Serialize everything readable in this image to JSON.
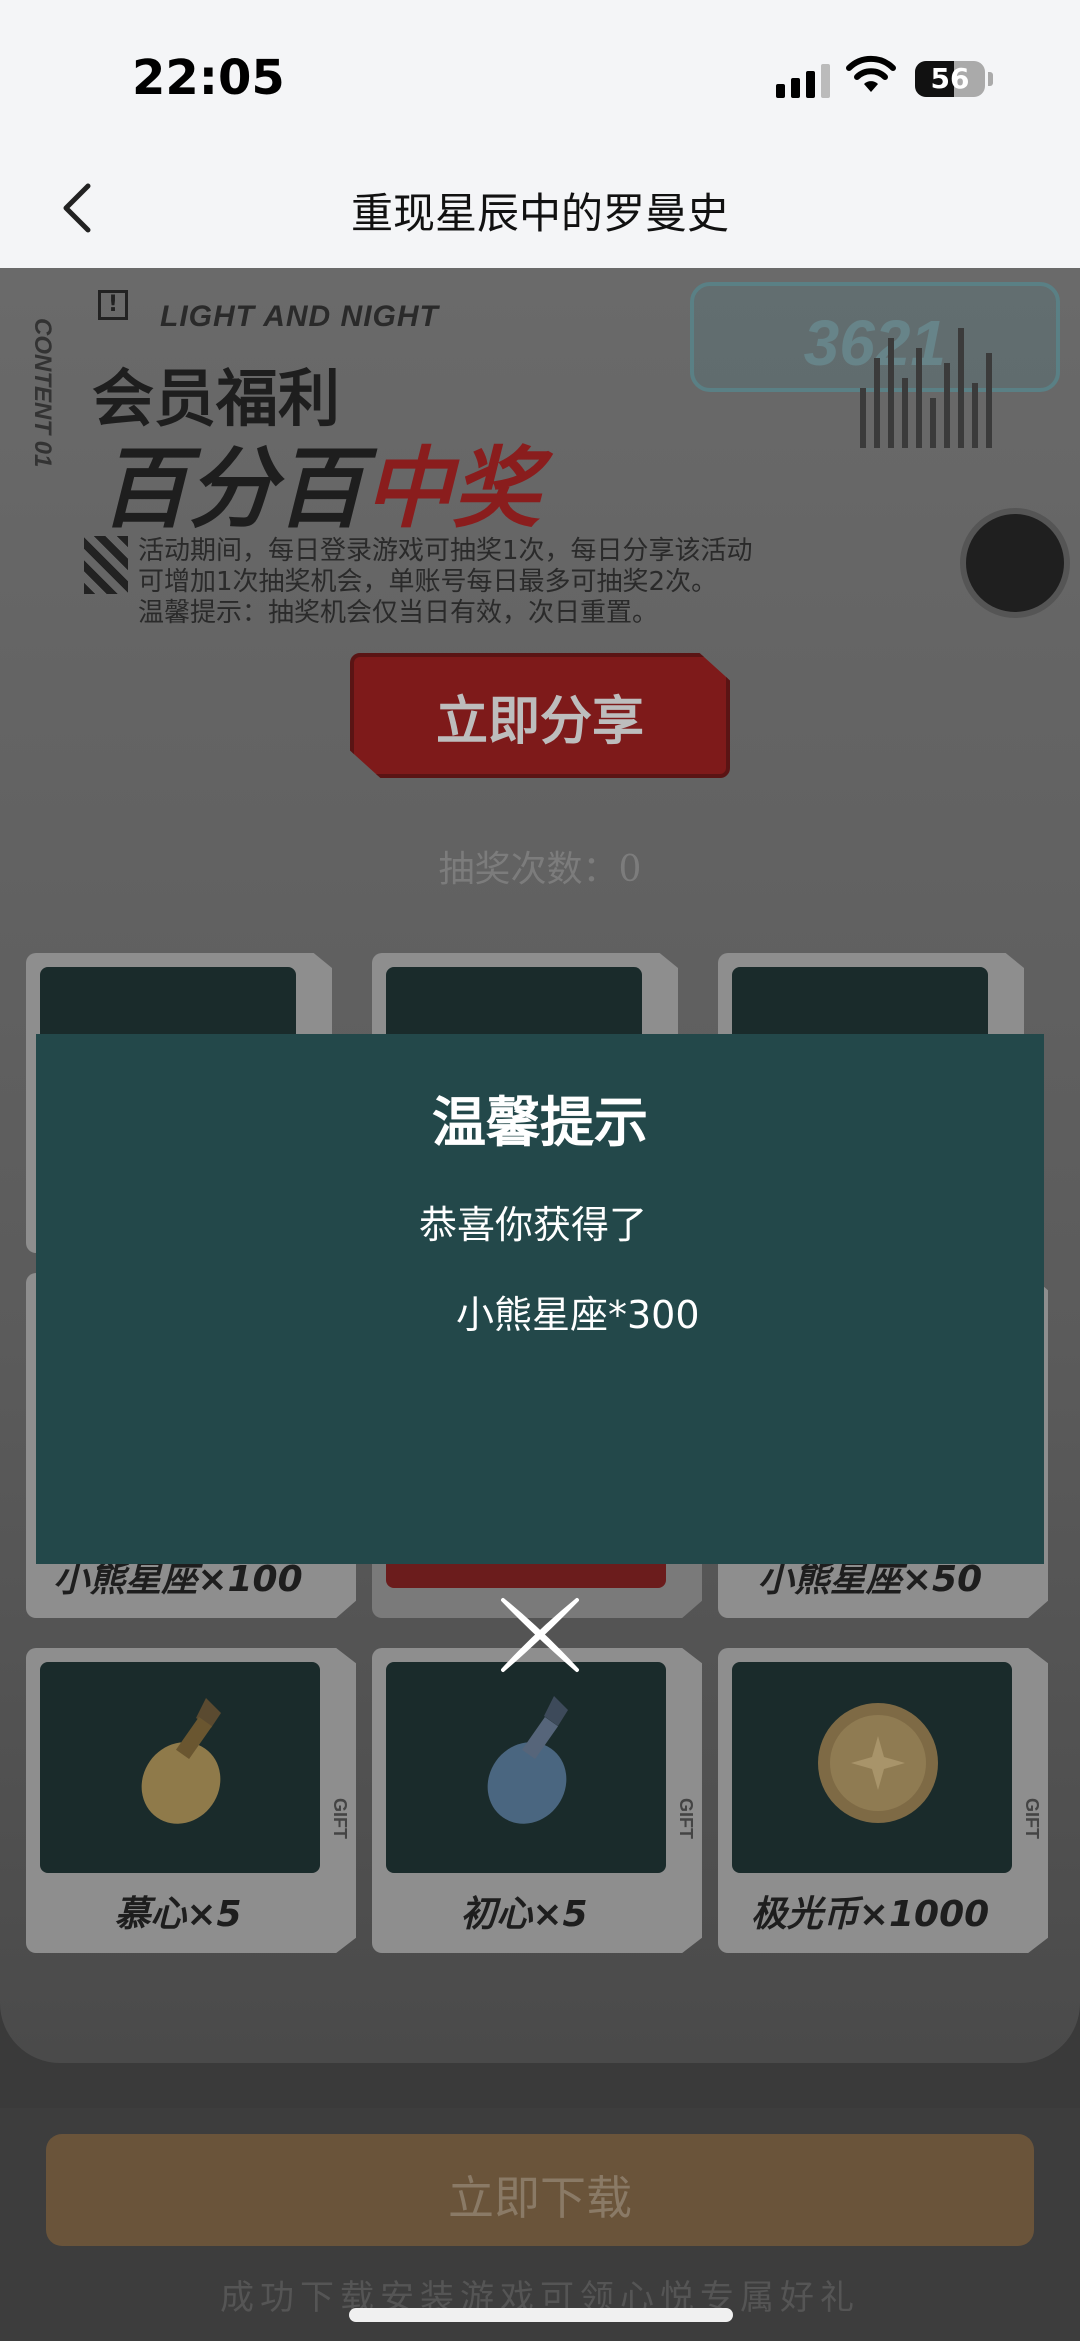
{
  "status_bar": {
    "time": "22:05",
    "battery": "56",
    "battery_level": 0.56
  },
  "nav": {
    "title": "重现星辰中的罗曼史"
  },
  "banner": {
    "tagline": "LIGHT AND NIGHT",
    "side_text": "CONTENT 01",
    "title_line1": "会员福利",
    "title_line2_a": "百分百",
    "title_line2_b": "中奖",
    "badge": "3621",
    "desc_lines": [
      "活动期间，每日登录游戏可抽奖1次，每日分享该活动",
      "可增加1次抽奖机会，单账号每日最多可抽奖2次。",
      "温馨提示：抽奖机会仅当日有效，次日重置。"
    ]
  },
  "share_button": {
    "label": "立即分享"
  },
  "draw_count": "抽奖次数：0",
  "prizes": {
    "row2": [
      {
        "label": "小熊星座×100"
      },
      {
        "label": ""
      },
      {
        "label": "小熊星座×50"
      }
    ],
    "row3": [
      {
        "label": "慕心×5"
      },
      {
        "label": "初心×5"
      },
      {
        "label": "极光币×1000"
      }
    ],
    "gift_tag": "GIFT"
  },
  "modal": {
    "title": "温馨提示",
    "line1": "恭喜你获得了",
    "line2": "小熊星座*300"
  },
  "download": {
    "button": "立即下载",
    "hint": "成功下载安装游戏可领心悦专属好礼"
  }
}
